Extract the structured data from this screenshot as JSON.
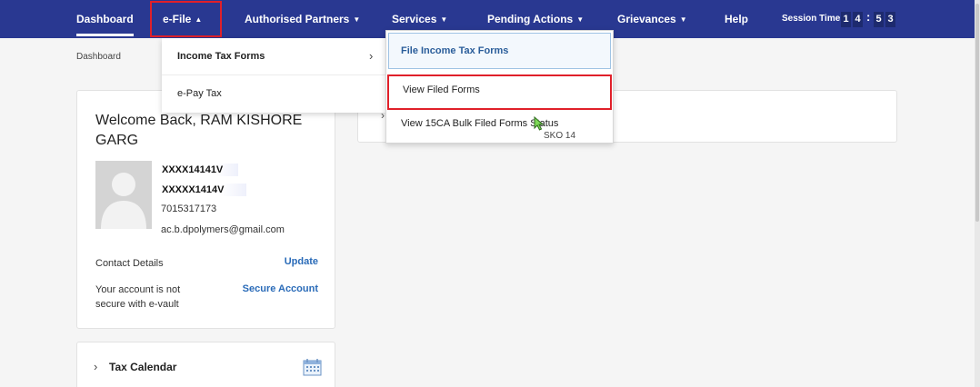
{
  "nav": {
    "items": [
      {
        "label": "Dashboard"
      },
      {
        "label": "e-File"
      },
      {
        "label": "Authorised Partners"
      },
      {
        "label": "Services"
      },
      {
        "label": "Pending Actions"
      },
      {
        "label": "Grievances"
      },
      {
        "label": "Help"
      }
    ],
    "session_label": "Session Time",
    "session_digits": [
      "1",
      "4",
      "5",
      "3"
    ],
    "session_separator": ":"
  },
  "breadcrumb": "Dashboard",
  "profile": {
    "welcome": "Welcome Back, RAM KISHORE GARG",
    "pan": "XXXX14141V",
    "aadhaar": "XXXXX1414V",
    "phone": "7015317173",
    "email": "ac.b.dpolymers@gmail.com",
    "contact_label": "Contact Details",
    "contact_link": "Update",
    "vault_text": "Your account is not secure with e-vault",
    "vault_link": "Secure Account"
  },
  "tax_calendar": {
    "label": "Tax Calendar"
  },
  "efile_menu": {
    "items": [
      {
        "label": "Income Tax Forms"
      },
      {
        "label": "e-Pay Tax"
      }
    ]
  },
  "income_tax_forms_menu": {
    "items": [
      {
        "label": "File Income Tax Forms"
      },
      {
        "label": "View Filed Forms"
      },
      {
        "label": "View 15CA Bulk Filed Forms Status"
      }
    ]
  },
  "overlay_caption": "SKO  14",
  "colors": {
    "nav_bg": "#293891",
    "highlight_red": "#e0202a",
    "link_blue": "#2a6bb8"
  },
  "icons": [
    "chevron-up-icon",
    "chevron-down-icon",
    "chevron-right-icon",
    "avatar-placeholder-icon",
    "calendar-icon",
    "mouse-cursor-icon"
  ]
}
